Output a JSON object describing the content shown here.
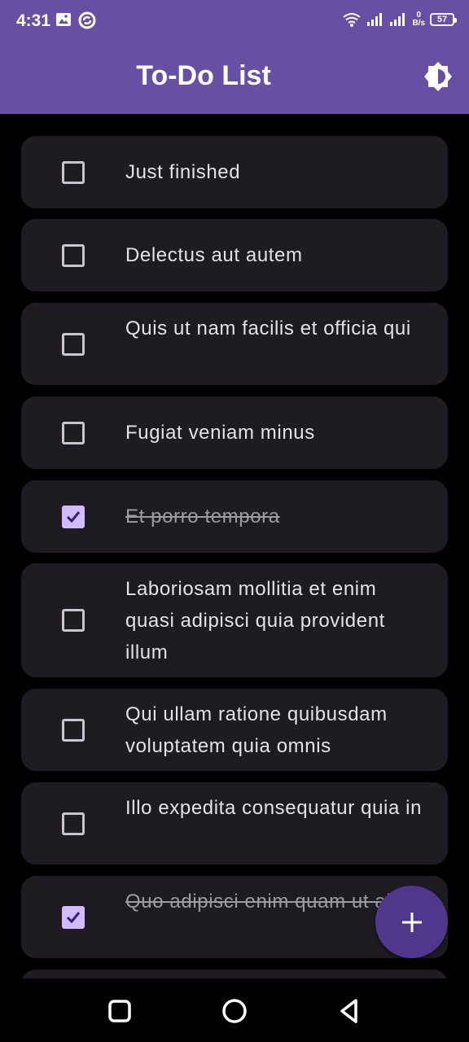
{
  "status_bar": {
    "time": "4:31",
    "net_speed_value": "0",
    "net_speed_unit": "B/s",
    "battery": "57"
  },
  "app_bar": {
    "title": "To-Do List"
  },
  "todos": [
    {
      "text": "Just finished",
      "checked": false
    },
    {
      "text": "Delectus aut autem",
      "checked": false
    },
    {
      "text": "Quis ut nam facilis et officia qui",
      "checked": false
    },
    {
      "text": "Fugiat veniam minus",
      "checked": false
    },
    {
      "text": "Et porro tempora",
      "checked": true
    },
    {
      "text": "Laboriosam mollitia et enim quasi adipisci quia provident illum",
      "checked": false
    },
    {
      "text": "Qui ullam ratione quibusdam voluptatem quia omnis",
      "checked": false
    },
    {
      "text": "Illo expedita consequatur quia in",
      "checked": false
    },
    {
      "text": "Quo adipisci enim quam ut ab",
      "checked": true
    }
  ],
  "colors": {
    "app_bar": "#6750a4",
    "card": "#1e1c22",
    "checkbox_checked": "#d0bcff",
    "fab": "#4f378b"
  },
  "icons": {
    "theme": "brightness-icon",
    "fab": "plus-icon",
    "nav_recents": "square-icon",
    "nav_home": "circle-icon",
    "nav_back": "triangle-back-icon"
  }
}
